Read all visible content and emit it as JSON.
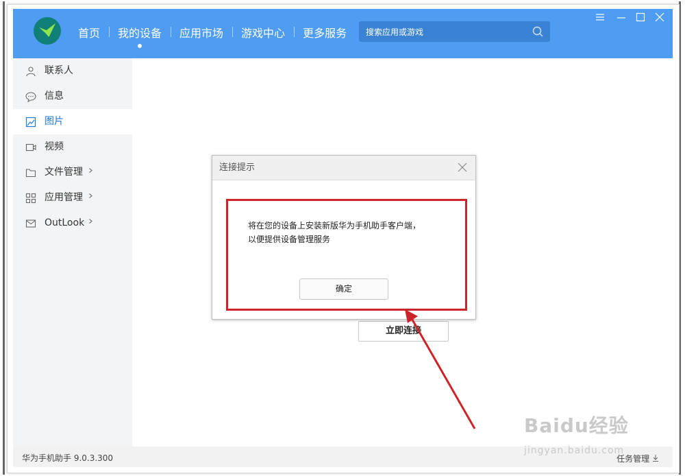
{
  "header": {
    "nav": [
      "首页",
      "我的设备",
      "应用市场",
      "游戏中心",
      "更多服务"
    ],
    "search_placeholder": "搜索应用或游戏"
  },
  "sidebar": {
    "items": [
      {
        "label": "联系人",
        "icon": "contact-icon"
      },
      {
        "label": "信息",
        "icon": "message-icon"
      },
      {
        "label": "图片",
        "icon": "image-icon",
        "active": true
      },
      {
        "label": "视频",
        "icon": "video-icon"
      },
      {
        "label": "文件管理",
        "icon": "folder-icon",
        "chevron": true
      },
      {
        "label": "应用管理",
        "icon": "apps-icon",
        "chevron": true
      },
      {
        "label": "OutLook",
        "icon": "mail-icon",
        "chevron": true
      }
    ]
  },
  "dialog": {
    "title": "连接提示",
    "message_line1": "将在您的设备上安装新版华为手机助手客户端，",
    "message_line2": "以便提供设备管理服务",
    "ok_label": "确定"
  },
  "main": {
    "connect_label": "立即连接"
  },
  "status": {
    "version": "华为手机助手 9.0.3.300",
    "task_label": "任务管理"
  },
  "watermark": {
    "brand": "Baidu经验",
    "url": "jingyan.baidu.com"
  },
  "colors": {
    "topbar": "#4e9df2",
    "accent": "#1f78d4",
    "highlight_box": "#cc2428"
  }
}
